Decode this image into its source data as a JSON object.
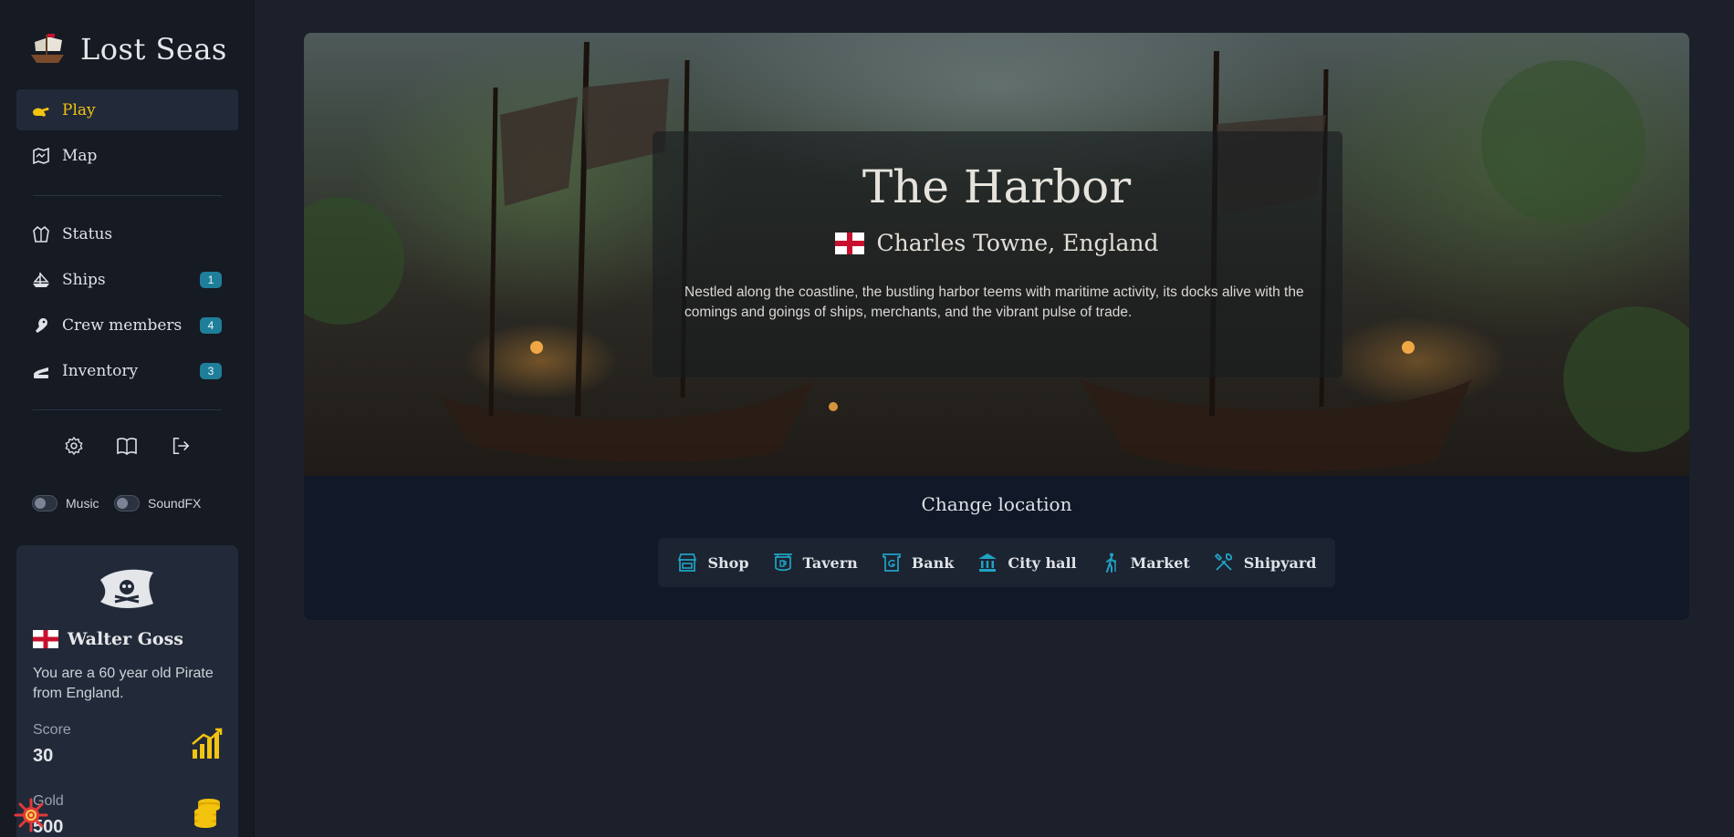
{
  "brand": {
    "title": "Lost Seas"
  },
  "nav": [
    {
      "label": "Play",
      "icon": "hand-pointing-icon",
      "active": true
    },
    {
      "label": "Map",
      "icon": "map-icon"
    }
  ],
  "nav2": [
    {
      "label": "Status",
      "icon": "coat-icon"
    },
    {
      "label": "Ships",
      "icon": "ship-icon",
      "badge": "1"
    },
    {
      "label": "Crew members",
      "icon": "parrot-icon",
      "badge": "4"
    },
    {
      "label": "Inventory",
      "icon": "scroll-icon",
      "badge": "3"
    }
  ],
  "toggles": {
    "music": "Music",
    "soundfx": "SoundFX"
  },
  "player": {
    "name": "Walter Goss",
    "description": "You are a 60 year old Pirate from England.",
    "score_label": "Score",
    "score_value": "30",
    "gold_label": "Gold",
    "gold_value": "500"
  },
  "location": {
    "title": "The Harbor",
    "place": "Charles Towne, England",
    "description": "Nestled along the coastline, the bustling harbor teems with maritime activity, its docks alive with the comings and goings of ships, merchants, and the vibrant pulse of trade."
  },
  "change": {
    "title": "Change location",
    "buttons": [
      "Shop",
      "Tavern",
      "Bank",
      "City hall",
      "Market",
      "Shipyard"
    ]
  },
  "colors": {
    "accent": "#f2c40f",
    "badge": "#1f7f9a",
    "icon_teal": "#1fa3c4",
    "flag_red": "#c8102e"
  }
}
